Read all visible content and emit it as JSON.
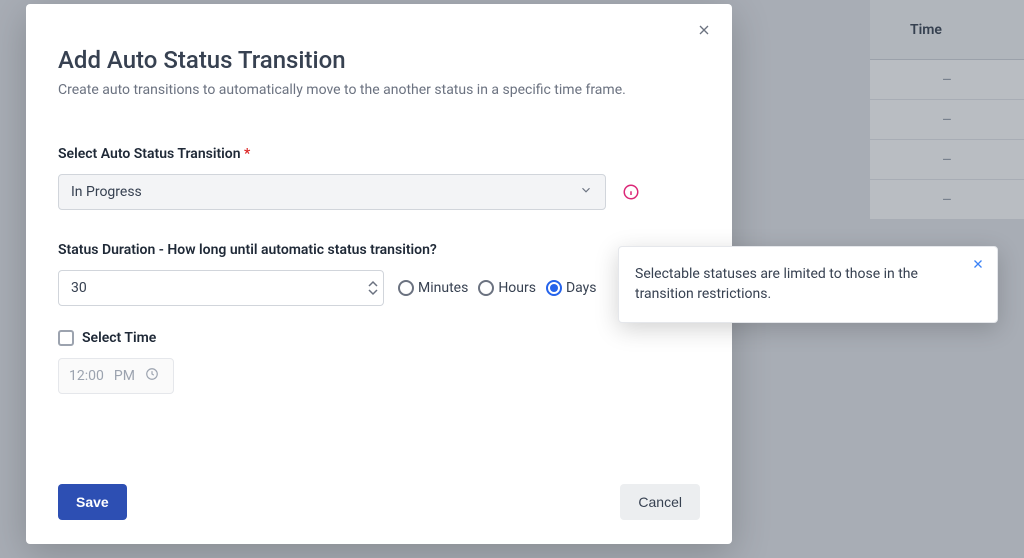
{
  "background": {
    "column_header": "Time",
    "empty_cell": "–"
  },
  "modal": {
    "title": "Add Auto Status Transition",
    "description": "Create auto transitions to automatically move to the another status in a specific time frame.",
    "select_label": "Select Auto Status Transition",
    "required_mark": "*",
    "select_value": "In Progress",
    "duration_label": "Status Duration - How long until automatic status transition?",
    "duration_value": "30",
    "units": {
      "minutes": "Minutes",
      "hours": "Hours",
      "days": "Days",
      "selected": "days"
    },
    "select_time_label": "Select Time",
    "time_value": "12:00",
    "time_meridiem": "PM",
    "save_label": "Save",
    "cancel_label": "Cancel"
  },
  "tooltip": {
    "text": "Selectable statuses are limited to those in the transition restrictions."
  }
}
